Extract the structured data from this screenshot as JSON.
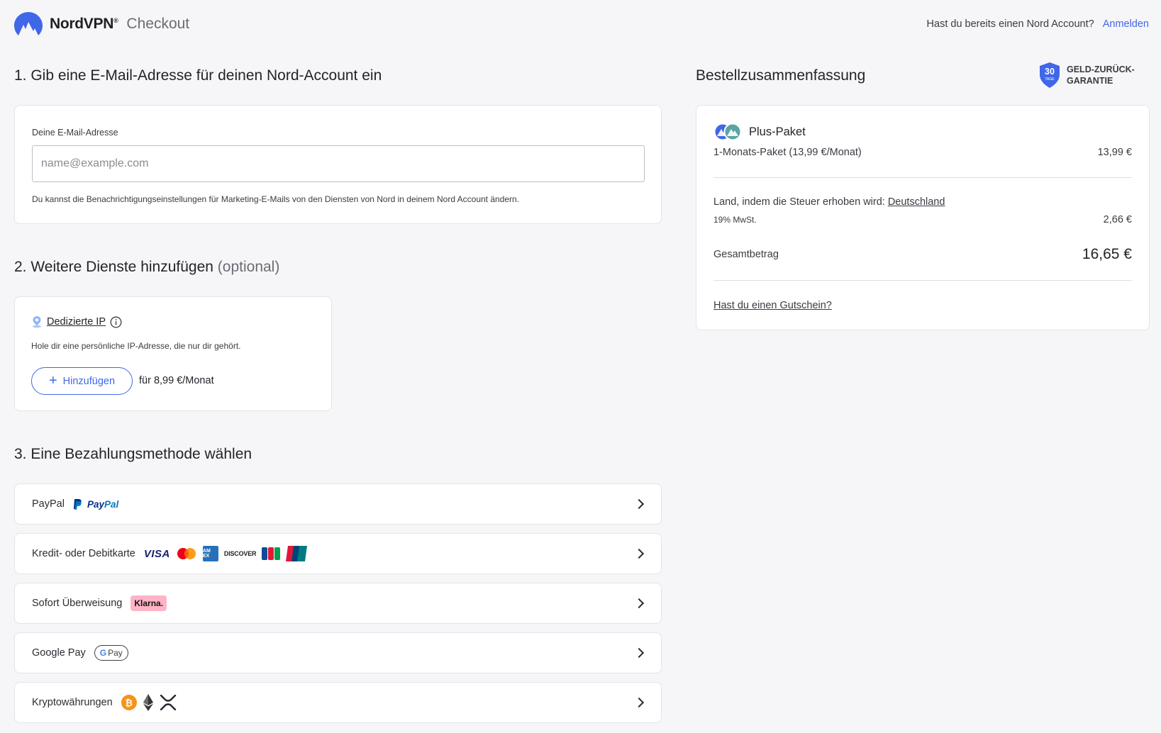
{
  "header": {
    "brand": "NordVPN",
    "brand_sup": "®",
    "page_title": "Checkout",
    "account_question": "Hast du bereits einen Nord Account?",
    "login_link": "Anmelden"
  },
  "step1": {
    "title": "1. Gib eine E-Mail-Adresse für deinen Nord-Account ein",
    "email_label": "Deine E-Mail-Adresse",
    "email_placeholder": "name@example.com",
    "email_value": "",
    "note": "Du kannst die Benachrichtigungseinstellungen für Marketing-E-Mails von den Diensten von Nord in deinem Nord Account ändern."
  },
  "step2": {
    "title": "2. Weitere Dienste hinzufügen",
    "optional": "(optional)",
    "addon": {
      "name": "Dedizierte IP",
      "description": "Hole dir eine persönliche IP-Adresse, die nur dir gehört.",
      "button": "Hinzufügen",
      "price": "für 8,99 €/Monat"
    }
  },
  "step3": {
    "title": "3. Eine Bezahlungsmethode wählen",
    "methods": [
      {
        "label": "PayPal",
        "logos": [
          "paypal-logo"
        ]
      },
      {
        "label": "Kredit- oder Debitkarte",
        "logos": [
          "visa-logo",
          "mastercard-logo",
          "amex-logo",
          "discover-logo",
          "jcb-logo",
          "unionpay-logo"
        ]
      },
      {
        "label": "Sofort Überweisung",
        "logos": [
          "klarna-logo"
        ]
      },
      {
        "label": "Google Pay",
        "logos": [
          "google-pay-logo"
        ]
      },
      {
        "label": "Kryptowährungen",
        "logos": [
          "bitcoin-icon",
          "ethereum-icon",
          "ripple-icon"
        ]
      }
    ],
    "logo_text": {
      "paypal_pay": "Pay",
      "paypal_pal": "Pal",
      "visa": "VISA",
      "amex": "AM EX",
      "discover": "DISCOVER",
      "klarna": "Klarna.",
      "gpay_g": "G",
      "gpay_pay": "Pay",
      "bitcoin": "₿"
    }
  },
  "summary": {
    "title": "Bestellzusammenfassung",
    "money_back_days": "30",
    "money_back_unit": "TAGE",
    "money_back_line1": "GELD-ZURÜCK-",
    "money_back_line2": "GARANTIE",
    "plan_name": "Plus-Paket",
    "plan_period": "1-Monats-Paket (13,99 €/Monat)",
    "plan_price": "13,99 €",
    "tax_country_label": "Land, indem die Steuer erhoben wird:",
    "tax_country": "Deutschland",
    "vat_label": "19% MwSt.",
    "vat_amount": "2,66 €",
    "total_label": "Gesamtbetrag",
    "total_amount": "16,65 €",
    "voucher": "Hast du einen Gutschein?"
  },
  "colors": {
    "accent": "#4067e8",
    "background": "#f6f6f8",
    "card": "#ffffff"
  }
}
